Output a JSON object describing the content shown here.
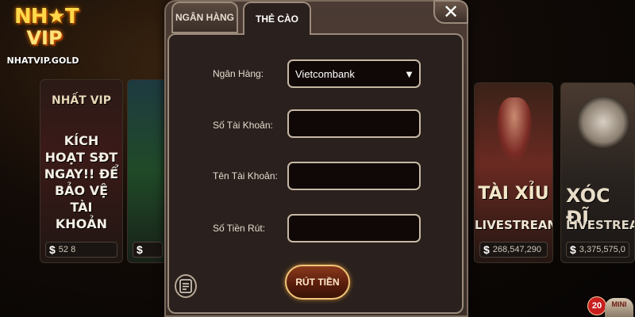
{
  "brand": {
    "logo_top": "NH★T",
    "logo_mid": "VIP",
    "domain": "NHATVIP.GOLD"
  },
  "background": {
    "promo_tile": {
      "logo": "NHẤT VIP",
      "text": "KÍCH HOẠT SĐT NGAY!! ĐỂ BẢO VỆ TÀI KHOẢN",
      "amount_prefix": "$",
      "amount": "52 8"
    },
    "game_tile_2": {
      "amount_prefix": "$",
      "amount": ""
    },
    "taixiu": {
      "title": "TÀI XỈU",
      "subtitle": "LIVESTREAM",
      "amount_prefix": "$",
      "amount": "268,547,290"
    },
    "xocdia": {
      "title": "XÓC ĐĨ",
      "subtitle": "LIVESTREA",
      "amount_prefix": "$",
      "amount": "3,375,575,0"
    },
    "badge_count": "20",
    "mini_label": "MINI"
  },
  "dialog": {
    "tabs": [
      {
        "label": "NGÂN HÀNG",
        "active": false
      },
      {
        "label": "THẺ CÀO",
        "active": true
      }
    ],
    "close_glyph": "✕",
    "form": {
      "bank_label": "Ngân Hàng:",
      "bank_value": "Vietcombank",
      "account_number_label": "Số Tài Khoản:",
      "account_number_value": "",
      "account_name_label": "Tên Tài Khoản:",
      "account_name_value": "",
      "amount_label": "Số Tiền Rút:",
      "amount_value": ""
    },
    "submit_label": "RÚT TIỀN",
    "history_icon": "history-icon"
  },
  "colors": {
    "accent_gold": "#f0c67a",
    "panel_bg": "#2a201d",
    "field_bg": "#100806",
    "button_red": "#8a3a1c"
  }
}
